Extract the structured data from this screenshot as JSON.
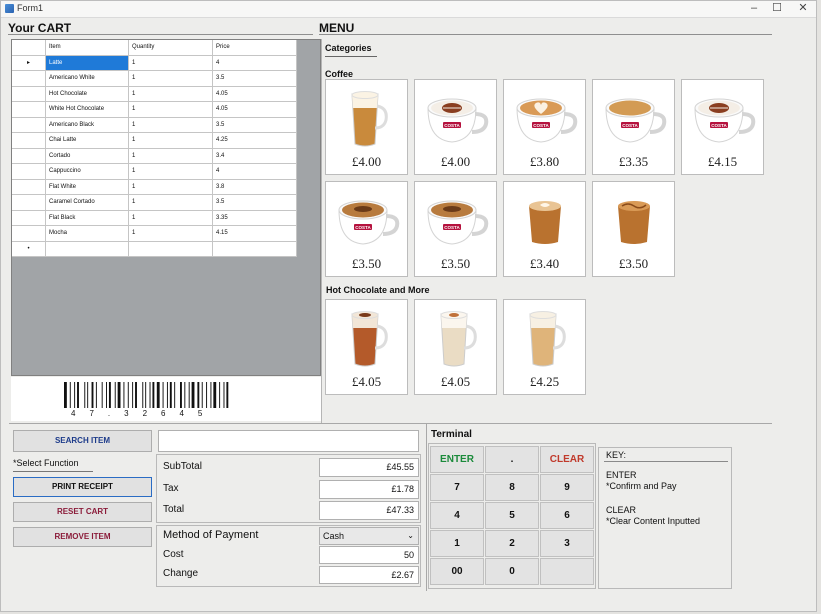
{
  "window": {
    "title": "Form1",
    "controls": [
      "–",
      "☐",
      "✕"
    ]
  },
  "cart": {
    "header": "Your CART",
    "columns": [
      "Item",
      "Quantity",
      "Price"
    ],
    "rows": [
      {
        "item": "Latte",
        "qty": "1",
        "price": "4"
      },
      {
        "item": "Americano White",
        "qty": "1",
        "price": "3.5"
      },
      {
        "item": "Hot Chocolate",
        "qty": "1",
        "price": "4.05"
      },
      {
        "item": "White Hot Chocolate",
        "qty": "1",
        "price": "4.05"
      },
      {
        "item": "Americano Black",
        "qty": "1",
        "price": "3.5"
      },
      {
        "item": "Chai Latte",
        "qty": "1",
        "price": "4.25"
      },
      {
        "item": "Cortado",
        "qty": "1",
        "price": "3.4"
      },
      {
        "item": "Cappuccino",
        "qty": "1",
        "price": "4"
      },
      {
        "item": "Flat White",
        "qty": "1",
        "price": "3.8"
      },
      {
        "item": "Caramel Cortado",
        "qty": "1",
        "price": "3.5"
      },
      {
        "item": "Flat Black",
        "qty": "1",
        "price": "3.35"
      },
      {
        "item": "Mocha",
        "qty": "1",
        "price": "4.15"
      }
    ],
    "current_row_marker": "▸",
    "new_row_marker": "•",
    "barcode_number": "47.32645"
  },
  "menu": {
    "header": "MENU",
    "categories_label": "Categories",
    "coffee_label": "Coffee",
    "hot_choc_label": "Hot Chocolate and More",
    "coffee": [
      {
        "price": "£4.00",
        "kind": "glass-latte"
      },
      {
        "price": "£4.00",
        "kind": "cup-bean"
      },
      {
        "price": "£3.80",
        "kind": "cup-heart"
      },
      {
        "price": "£3.35",
        "kind": "cup-plain"
      },
      {
        "price": "£4.15",
        "kind": "cup-bean"
      },
      {
        "price": "£3.50",
        "kind": "cup-dark"
      },
      {
        "price": "£3.50",
        "kind": "cup-dark"
      },
      {
        "price": "£3.40",
        "kind": "small-glass"
      },
      {
        "price": "£3.50",
        "kind": "small-glass-caramel"
      }
    ],
    "hot": [
      {
        "price": "£4.05",
        "kind": "glass-choc"
      },
      {
        "price": "£4.05",
        "kind": "glass-white"
      },
      {
        "price": "£4.25",
        "kind": "glass-chai"
      }
    ],
    "brand_text": "COSTA"
  },
  "actions": {
    "search": "SEARCH ITEM",
    "search_value": "",
    "select_function": "*Select Function",
    "print": "PRINT RECEIPT",
    "reset": "RESET CART",
    "remove": "REMOVE ITEM"
  },
  "totals": {
    "subtotal_label": "SubTotal",
    "subtotal": "£45.55",
    "tax_label": "Tax",
    "tax": "£1.78",
    "total_label": "Total",
    "total": "£47.33",
    "method_label": "Method of Payment",
    "method": "Cash",
    "cost_label": "Cost",
    "cost": "50",
    "change_label": "Change",
    "change": "£2.67"
  },
  "terminal": {
    "title": "Terminal",
    "keys": [
      [
        "ENTER",
        ".",
        "CLEAR"
      ],
      [
        "7",
        "8",
        "9"
      ],
      [
        "4",
        "5",
        "6"
      ],
      [
        "1",
        "2",
        "3"
      ],
      [
        "00",
        "0",
        ""
      ]
    ],
    "enter_color": "#1a8a3a",
    "clear_color": "#c0392b"
  },
  "legend": {
    "title": "KEY:",
    "enter_label": "ENTER",
    "enter_desc": "*Confirm and Pay",
    "clear_label": "CLEAR",
    "clear_desc": "*Clear Content Inputted"
  }
}
